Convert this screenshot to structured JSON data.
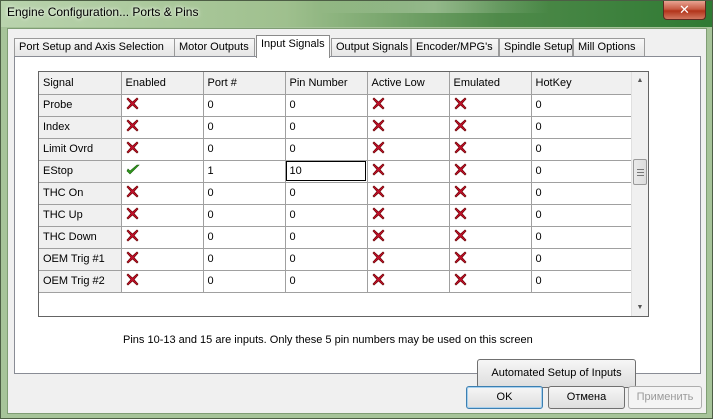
{
  "window": {
    "title": "Engine Configuration... Ports & Pins",
    "close_glyph": "✕"
  },
  "tabs": [
    {
      "label": "Port Setup and Axis Selection",
      "active": false
    },
    {
      "label": "Motor Outputs",
      "active": false
    },
    {
      "label": "Input Signals",
      "active": true
    },
    {
      "label": "Output Signals",
      "active": false
    },
    {
      "label": "Encoder/MPG's",
      "active": false
    },
    {
      "label": "Spindle Setup",
      "active": false
    },
    {
      "label": "Mill Options",
      "active": false
    }
  ],
  "grid": {
    "columns": [
      "Signal",
      "Enabled",
      "Port #",
      "Pin Number",
      "Active Low",
      "Emulated",
      "HotKey"
    ],
    "rows": [
      {
        "signal": "Probe",
        "enabled": "red-x-icon",
        "port": "0",
        "pin": "0",
        "active_low": "red-x-icon",
        "emulated": "red-x-icon",
        "hotkey": "0"
      },
      {
        "signal": "Index",
        "enabled": "red-x-icon",
        "port": "0",
        "pin": "0",
        "active_low": "red-x-icon",
        "emulated": "red-x-icon",
        "hotkey": "0"
      },
      {
        "signal": "Limit Ovrd",
        "enabled": "red-x-icon",
        "port": "0",
        "pin": "0",
        "active_low": "red-x-icon",
        "emulated": "red-x-icon",
        "hotkey": "0"
      },
      {
        "signal": "EStop",
        "enabled": "green-check-icon",
        "port": "1",
        "pin": "10",
        "active_low": "red-x-icon",
        "emulated": "red-x-icon",
        "hotkey": "0",
        "selected_cell": "pin"
      },
      {
        "signal": "THC On",
        "enabled": "red-x-icon",
        "port": "0",
        "pin": "0",
        "active_low": "red-x-icon",
        "emulated": "red-x-icon",
        "hotkey": "0"
      },
      {
        "signal": "THC Up",
        "enabled": "red-x-icon",
        "port": "0",
        "pin": "0",
        "active_low": "red-x-icon",
        "emulated": "red-x-icon",
        "hotkey": "0"
      },
      {
        "signal": "THC Down",
        "enabled": "red-x-icon",
        "port": "0",
        "pin": "0",
        "active_low": "red-x-icon",
        "emulated": "red-x-icon",
        "hotkey": "0"
      },
      {
        "signal": "OEM Trig #1",
        "enabled": "red-x-icon",
        "port": "0",
        "pin": "0",
        "active_low": "red-x-icon",
        "emulated": "red-x-icon",
        "hotkey": "0"
      },
      {
        "signal": "OEM Trig #2",
        "enabled": "red-x-icon",
        "port": "0",
        "pin": "0",
        "active_low": "red-x-icon",
        "emulated": "red-x-icon",
        "hotkey": "0"
      }
    ]
  },
  "hint": "Pins 10-13 and 15 are inputs. Only these 5 pin numbers may be used on this screen",
  "buttons": {
    "automated_setup": "Automated Setup of Inputs",
    "ok": "OK",
    "cancel": "Отмена",
    "apply": "Применить"
  },
  "colors": {
    "x_red": "#c8102e",
    "check_green": "#2f9a1c"
  }
}
